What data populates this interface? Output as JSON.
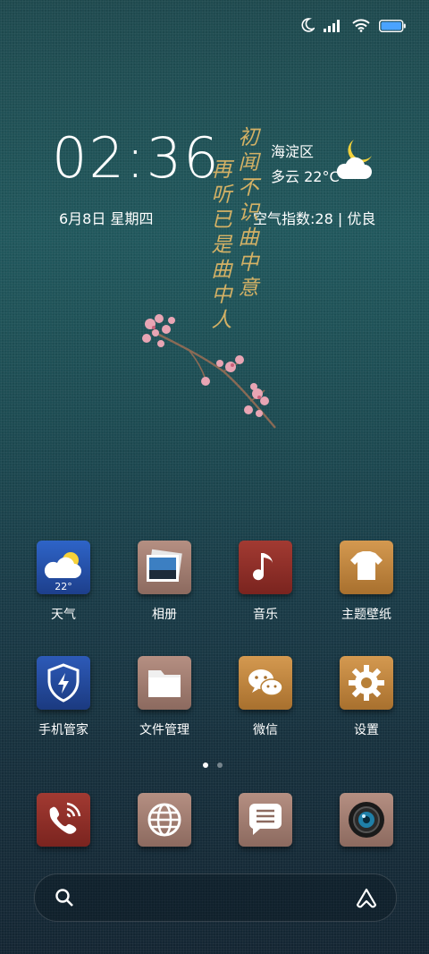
{
  "clock": {
    "time": "02:36",
    "date": "6月8日 星期四"
  },
  "weather": {
    "location": "海淀区",
    "condition": "多云 22°C",
    "aqi": "空气指数:28 | 优良"
  },
  "poem": {
    "line1": "初闻不识曲中意",
    "line2": "再听已是曲中人"
  },
  "apps_row1": [
    {
      "label": "天气",
      "icon": "weather-icon",
      "badge": "22°"
    },
    {
      "label": "相册",
      "icon": "gallery-icon"
    },
    {
      "label": "音乐",
      "icon": "music-icon"
    },
    {
      "label": "主题壁纸",
      "icon": "themes-icon"
    }
  ],
  "apps_row2": [
    {
      "label": "手机管家",
      "icon": "security-icon"
    },
    {
      "label": "文件管理",
      "icon": "folder-icon"
    },
    {
      "label": "微信",
      "icon": "wechat-icon"
    },
    {
      "label": "设置",
      "icon": "settings-icon"
    }
  ],
  "dock": [
    {
      "icon": "phone-icon"
    },
    {
      "icon": "browser-icon"
    },
    {
      "icon": "messages-icon"
    },
    {
      "icon": "camera-icon"
    }
  ],
  "page_indicator": {
    "count": 2,
    "active": 0
  },
  "colors": {
    "accent_gold": "#d4b165",
    "battery": "#4aa3ff"
  }
}
